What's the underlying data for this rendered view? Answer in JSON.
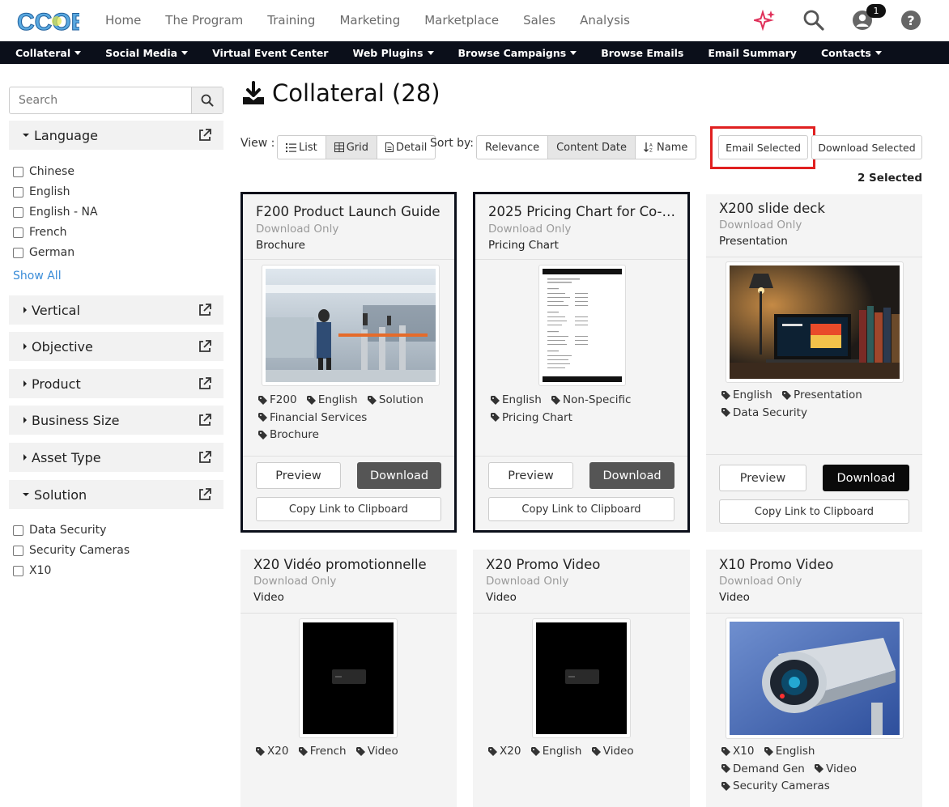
{
  "brand": {
    "logo_text": "CCOE"
  },
  "topnav": {
    "items": [
      "Home",
      "The Program",
      "Training",
      "Marketing",
      "Marketplace",
      "Sales",
      "Analysis"
    ],
    "notification_count": "1"
  },
  "subnav": {
    "items": [
      {
        "label": "Collateral",
        "dropdown": true
      },
      {
        "label": "Social Media",
        "dropdown": true
      },
      {
        "label": "Virtual Event Center",
        "dropdown": false
      },
      {
        "label": "Web Plugins",
        "dropdown": true
      },
      {
        "label": "Browse Campaigns",
        "dropdown": true
      },
      {
        "label": "Browse Emails",
        "dropdown": false
      },
      {
        "label": "Email Summary",
        "dropdown": false
      },
      {
        "label": "Contacts",
        "dropdown": true
      }
    ]
  },
  "sidebar": {
    "search_placeholder": "Search",
    "facets": [
      {
        "label": "Language",
        "expanded": true,
        "options": [
          "Chinese",
          "English",
          "English - NA",
          "French",
          "German"
        ],
        "show_all": "Show All"
      },
      {
        "label": "Vertical",
        "expanded": false
      },
      {
        "label": "Objective",
        "expanded": false
      },
      {
        "label": "Product",
        "expanded": false
      },
      {
        "label": "Business Size",
        "expanded": false
      },
      {
        "label": "Asset Type",
        "expanded": false
      },
      {
        "label": "Solution",
        "expanded": true,
        "options": [
          "Data Security",
          "Security Cameras",
          "X10"
        ]
      }
    ]
  },
  "header": {
    "title": "Collateral (28)",
    "view_label": "View :",
    "views": [
      "List",
      "Grid",
      "Detail"
    ],
    "active_view": "Grid",
    "sort_label": "Sort by:",
    "sorts": [
      "Relevance",
      "Content Date",
      "Name"
    ],
    "active_sort": "Content Date",
    "email_selected": "Email Selected",
    "download_selected": "Download Selected",
    "selected_count": "2 Selected"
  },
  "cards": [
    {
      "title": "F200 Product Launch Guide",
      "sub": "Download Only",
      "type": "Brochure",
      "tags": [
        "F200",
        "English",
        "Solution",
        "Financial Services",
        "Brochure"
      ],
      "selected": true,
      "thumb": "photo-office",
      "preview": "Preview",
      "download": "Download",
      "copy": "Copy Link to Clipboard"
    },
    {
      "title": "2025 Pricing Chart for Co-S…",
      "sub": "Download Only",
      "type": "Pricing Chart",
      "tags": [
        "English",
        "Non-Specific",
        "Pricing Chart"
      ],
      "selected": true,
      "thumb": "document",
      "preview": "Preview",
      "download": "Download",
      "copy": "Copy Link to Clipboard"
    },
    {
      "title": "X200 slide deck",
      "sub": "Download Only",
      "type": "Presentation",
      "tags": [
        "English",
        "Presentation",
        "Data Security"
      ],
      "selected": false,
      "thumb": "photo-laptop",
      "preview": "Preview",
      "download": "Download",
      "copy": "Copy Link to Clipboard"
    },
    {
      "title": "X20 Vidéo promotionnelle",
      "sub": "Download Only",
      "type": "Video",
      "tags": [
        "X20",
        "French",
        "Video"
      ],
      "selected": false,
      "thumb": "video",
      "preview": "Preview",
      "download": "Download",
      "copy": "Copy Link to Clipboard"
    },
    {
      "title": "X20 Promo Video",
      "sub": "Download Only",
      "type": "Video",
      "tags": [
        "X20",
        "English",
        "Video"
      ],
      "selected": false,
      "thumb": "video",
      "preview": "Preview",
      "download": "Download",
      "copy": "Copy Link to Clipboard"
    },
    {
      "title": "X10 Promo Video",
      "sub": "Download Only",
      "type": "Video",
      "tags": [
        "X10",
        "English",
        "Demand Gen",
        "Video",
        "Security Cameras"
      ],
      "selected": false,
      "thumb": "photo-camera",
      "preview": "Preview",
      "download": "Download",
      "copy": "Copy Link to Clipboard"
    }
  ],
  "colors": {
    "dark_nav": "#0b0f1a",
    "highlight": "#e02020",
    "accent_blue": "#3a8cd8",
    "card_bg": "#f4f4f4"
  },
  "icons": [
    "sparkle-icon",
    "search-icon",
    "user-icon",
    "help-icon",
    "download-icon",
    "list-icon",
    "grid-icon",
    "detail-icon",
    "sort-icon",
    "external-link-icon",
    "tag-icon"
  ]
}
